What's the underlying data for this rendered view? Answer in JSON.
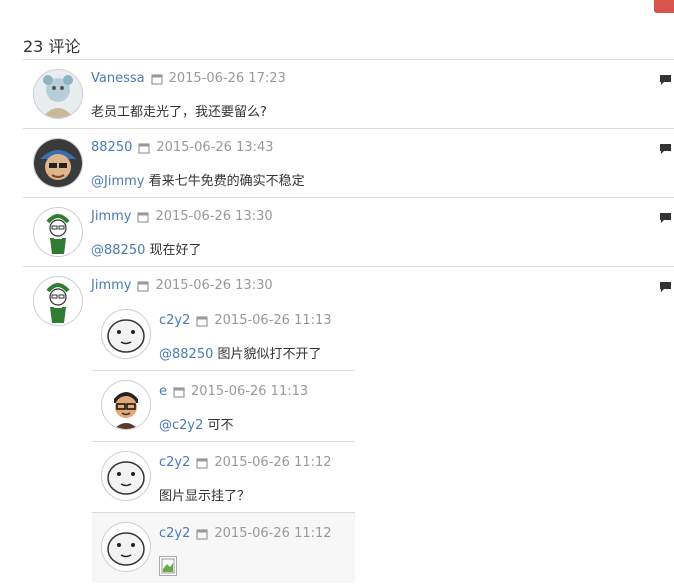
{
  "header": {
    "title": "23 评论"
  },
  "comments": [
    {
      "name": "Vanessa",
      "date": "2015-06-26 17:23",
      "text": "老员工都走光了，我还要留么?"
    },
    {
      "name": "88250",
      "date": "2015-06-26 13:43",
      "mention": "@Jimmy",
      "text": " 看来七牛免费的确实不稳定"
    },
    {
      "name": "Jimmy",
      "date": "2015-06-26 13:30",
      "mention": "@88250",
      "text": " 现在好了"
    },
    {
      "name": "Jimmy",
      "date": "2015-06-26 13:30"
    }
  ],
  "replies": [
    {
      "name": "c2y2",
      "date": "2015-06-26 11:13",
      "mention": "@88250",
      "text": " 图片貌似打不开了"
    },
    {
      "name": "e",
      "date": "2015-06-26 11:13",
      "mention": "@c2y2",
      "text": " 可不"
    },
    {
      "name": "c2y2",
      "date": "2015-06-26 11:12",
      "text": "图片显示挂了？"
    },
    {
      "name": "c2y2",
      "date": "2015-06-26 11:12"
    }
  ],
  "icons": {
    "calendar": "calendar-icon",
    "reply": "comment-bubble-icon",
    "broken_image": "broken-image-icon"
  },
  "colors": {
    "link": "#4a7ab5",
    "meta": "#999999",
    "divider": "#dddddd",
    "corner": "#d9534f"
  }
}
